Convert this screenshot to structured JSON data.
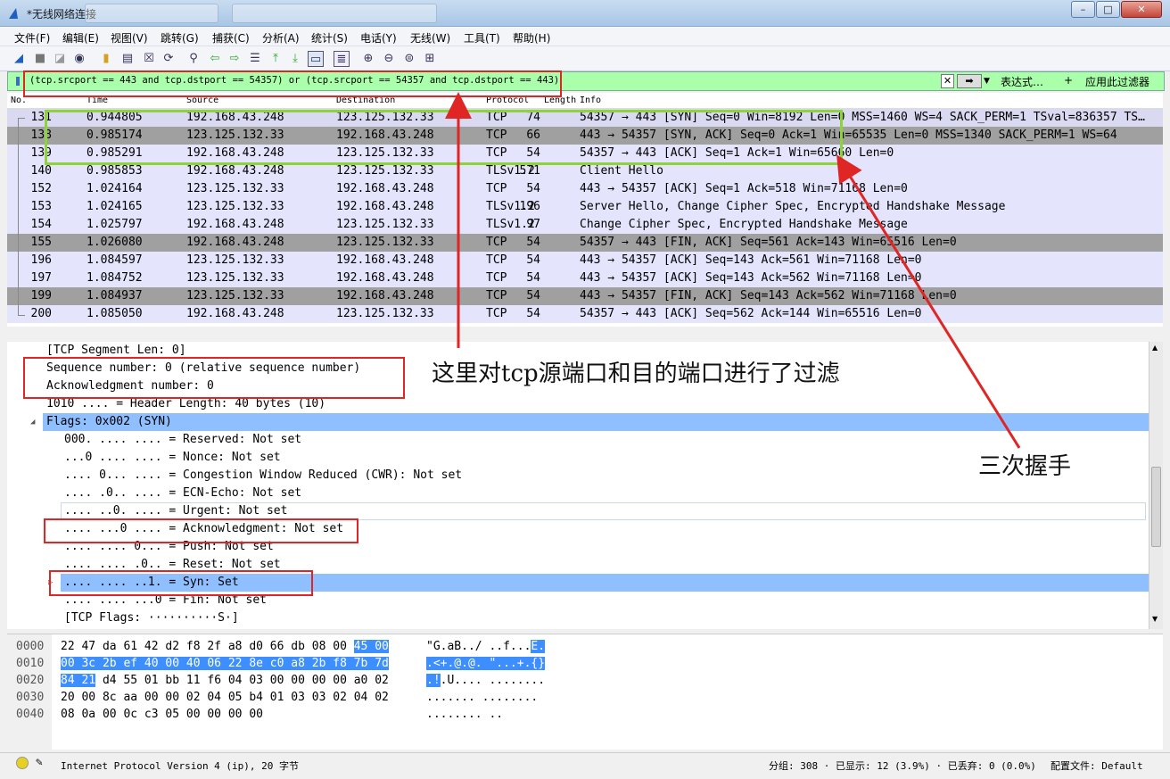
{
  "window": {
    "title": "*无线网络连接",
    "controls": {
      "minimize": "–",
      "maximize": "□",
      "close": "✕"
    }
  },
  "menu": [
    "文件(F)",
    "编辑(E)",
    "视图(V)",
    "跳转(G)",
    "捕获(C)",
    "分析(A)",
    "统计(S)",
    "电话(Y)",
    "无线(W)",
    "工具(T)",
    "帮助(H)"
  ],
  "filter": {
    "value": "(tcp.srcport == 443 and tcp.dstport == 54357) or (tcp.srcport == 54357 and tcp.dstport == 443)",
    "expression_label": "表达式…",
    "plus_label": "+",
    "apply_label": "应用此过滤器",
    "bg_color": "#aaffaa"
  },
  "packet_list": {
    "headers": [
      "No.",
      "Time",
      "Source",
      "Destination",
      "Protocol",
      "Length",
      "Info"
    ],
    "rows": [
      {
        "no": "131",
        "time": "0.944805",
        "src": "192.168.43.248",
        "dst": "123.125.132.33",
        "proto": "TCP",
        "len": "74",
        "info": "54357 → 443 [SYN] Seq=0 Win=8192 Len=0 MSS=1460 WS=4 SACK_PERM=1 TSval=836357 TS…",
        "style": "sel"
      },
      {
        "no": "138",
        "time": "0.985174",
        "src": "123.125.132.33",
        "dst": "192.168.43.248",
        "proto": "TCP",
        "len": "66",
        "info": "443 → 54357 [SYN, ACK] Seq=0 Ack=1 Win=65535 Len=0 MSS=1340 SACK_PERM=1 WS=64",
        "style": "gray"
      },
      {
        "no": "139",
        "time": "0.985291",
        "src": "192.168.43.248",
        "dst": "123.125.132.33",
        "proto": "TCP",
        "len": "54",
        "info": "54357 → 443 [ACK] Seq=1 Ack=1 Win=65660 Len=0",
        "style": "lav"
      },
      {
        "no": "140",
        "time": "0.985853",
        "src": "192.168.43.248",
        "dst": "123.125.132.33",
        "proto": "TLSv1.2",
        "len": "571",
        "info": "Client Hello",
        "style": "lav"
      },
      {
        "no": "152",
        "time": "1.024164",
        "src": "123.125.132.33",
        "dst": "192.168.43.248",
        "proto": "TCP",
        "len": "54",
        "info": "443 → 54357 [ACK] Seq=1 Ack=518 Win=71168 Len=0",
        "style": "lav"
      },
      {
        "no": "153",
        "time": "1.024165",
        "src": "123.125.132.33",
        "dst": "192.168.43.248",
        "proto": "TLSv1.2",
        "len": "196",
        "info": "Server Hello, Change Cipher Spec, Encrypted Handshake Message",
        "style": "lav"
      },
      {
        "no": "154",
        "time": "1.025797",
        "src": "192.168.43.248",
        "dst": "123.125.132.33",
        "proto": "TLSv1.2",
        "len": "97",
        "info": "Change Cipher Spec, Encrypted Handshake Message",
        "style": "lav"
      },
      {
        "no": "155",
        "time": "1.026080",
        "src": "192.168.43.248",
        "dst": "123.125.132.33",
        "proto": "TCP",
        "len": "54",
        "info": "54357 → 443 [FIN, ACK] Seq=561 Ack=143 Win=65516 Len=0",
        "style": "gray"
      },
      {
        "no": "196",
        "time": "1.084597",
        "src": "123.125.132.33",
        "dst": "192.168.43.248",
        "proto": "TCP",
        "len": "54",
        "info": "443 → 54357 [ACK] Seq=143 Ack=561 Win=71168 Len=0",
        "style": "lav"
      },
      {
        "no": "197",
        "time": "1.084752",
        "src": "123.125.132.33",
        "dst": "192.168.43.248",
        "proto": "TCP",
        "len": "54",
        "info": "443 → 54357 [ACK] Seq=143 Ack=562 Win=71168 Len=0",
        "style": "lav"
      },
      {
        "no": "199",
        "time": "1.084937",
        "src": "123.125.132.33",
        "dst": "192.168.43.248",
        "proto": "TCP",
        "len": "54",
        "info": "443 → 54357 [FIN, ACK] Seq=143 Ack=562 Win=71168 Len=0",
        "style": "gray"
      },
      {
        "no": "200",
        "time": "1.085050",
        "src": "192.168.43.248",
        "dst": "123.125.132.33",
        "proto": "TCP",
        "len": "54",
        "info": "54357 → 443 [ACK] Seq=562 Ack=144 Win=65516 Len=0",
        "style": "lav"
      }
    ]
  },
  "details": [
    {
      "text": "[TCP Segment Len: 0]",
      "indent": 44,
      "hl": false
    },
    {
      "text": "Sequence number: 0    (relative sequence number)",
      "indent": 44,
      "hl": false
    },
    {
      "text": "Acknowledgment number: 0",
      "indent": 44,
      "hl": false
    },
    {
      "text": "1010 .... = Header Length: 40 bytes (10)",
      "indent": 44,
      "hl": false
    },
    {
      "text": "Flags: 0x002 (SYN)",
      "indent": 44,
      "hl": true,
      "expander": "◢"
    },
    {
      "text": "000. .... .... = Reserved: Not set",
      "indent": 64,
      "hl": false
    },
    {
      "text": "...0 .... .... = Nonce: Not set",
      "indent": 64,
      "hl": false
    },
    {
      "text": ".... 0... .... = Congestion Window Reduced (CWR): Not set",
      "indent": 64,
      "hl": false
    },
    {
      "text": ".... .0.. .... = ECN-Echo: Not set",
      "indent": 64,
      "hl": false
    },
    {
      "text": ".... ..0. .... = Urgent: Not set",
      "indent": 64,
      "hl": false
    },
    {
      "text": ".... ...0 .... = Acknowledgment: Not set",
      "indent": 64,
      "hl": false
    },
    {
      "text": ".... .... 0... = Push: Not set",
      "indent": 64,
      "hl": false
    },
    {
      "text": ".... .... .0.. = Reset: Not set",
      "indent": 64,
      "hl": false
    },
    {
      "text": ".... .... ..1. = Syn: Set",
      "indent": 64,
      "hl": true,
      "expander": "▷"
    },
    {
      "text": ".... .... ...0 = Fin: Not set",
      "indent": 64,
      "hl": false
    },
    {
      "text": "[TCP Flags: ··········S·]",
      "indent": 64,
      "hl": false
    }
  ],
  "hex": [
    {
      "off": "0000",
      "a": "22 47 da 61 42 d2 f8 2f  a8 d0 66 db 08 00 ",
      "a_sel": "45 00",
      "asc": "\"G.aB../ ..f...",
      "asc_sel": "E."
    },
    {
      "off": "0010",
      "a": "",
      "a_sel": "00 3c 2b ef 40 00 40 06  22 8e c0 a8 2b f8 7b 7d",
      "asc": "",
      "asc_sel": ".<+.@.@. \"...+.{}"
    },
    {
      "off": "0020",
      "a_sel": "84 21",
      "a": " d4 55 01 bb 11 f6  04 03 00 00 00 00 a0 02",
      "asc_sel": ".!",
      "asc": ".U.... ........",
      "first_sel": true
    },
    {
      "off": "0030",
      "a": "20 00 8c aa 00 00 02 04  05 b4 01 03 03 02 04 02",
      "a_sel": "",
      "asc": " ....... ........",
      "asc_sel": ""
    },
    {
      "off": "0040",
      "a": "08 0a 00 0c c3 05 00 00  00 00",
      "a_sel": "",
      "asc": "........ ..",
      "asc_sel": ""
    }
  ],
  "status": {
    "protocol_text": "Internet Protocol Version 4 (ip), 20 字节",
    "packets": "分组: 308 · 已显示: 12 (3.9%) · 已丢弃: 0 (0.0%)",
    "profile": "配置文件: Default"
  },
  "annotations": {
    "filter_note": "这里对tcp源端口和目的端口进行了过滤",
    "handshake_note": "三次握手"
  },
  "colors": {
    "annotation_red": "#e02525",
    "annotation_green": "#8ed33a",
    "selection_blue": "#3d8eff"
  }
}
